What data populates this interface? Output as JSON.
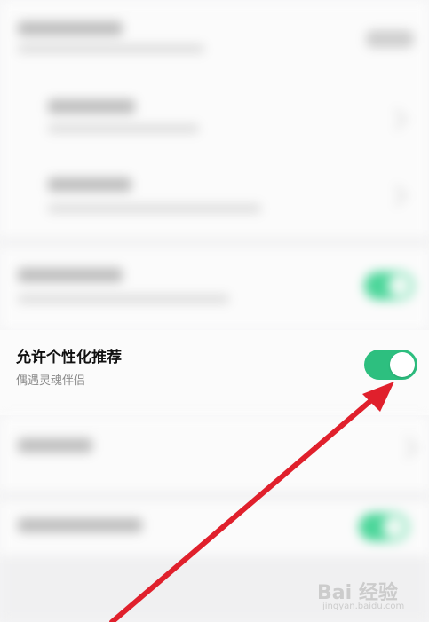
{
  "setting": {
    "title": "允许个性化推荐",
    "subtitle": "偶遇灵魂伴侣",
    "toggle_on": true
  },
  "colors": {
    "toggle_on": "#2dbf7f",
    "arrow": "#e0202c"
  },
  "watermark": {
    "logo": "Bai 经验",
    "url": "jingyan.baidu.com"
  }
}
